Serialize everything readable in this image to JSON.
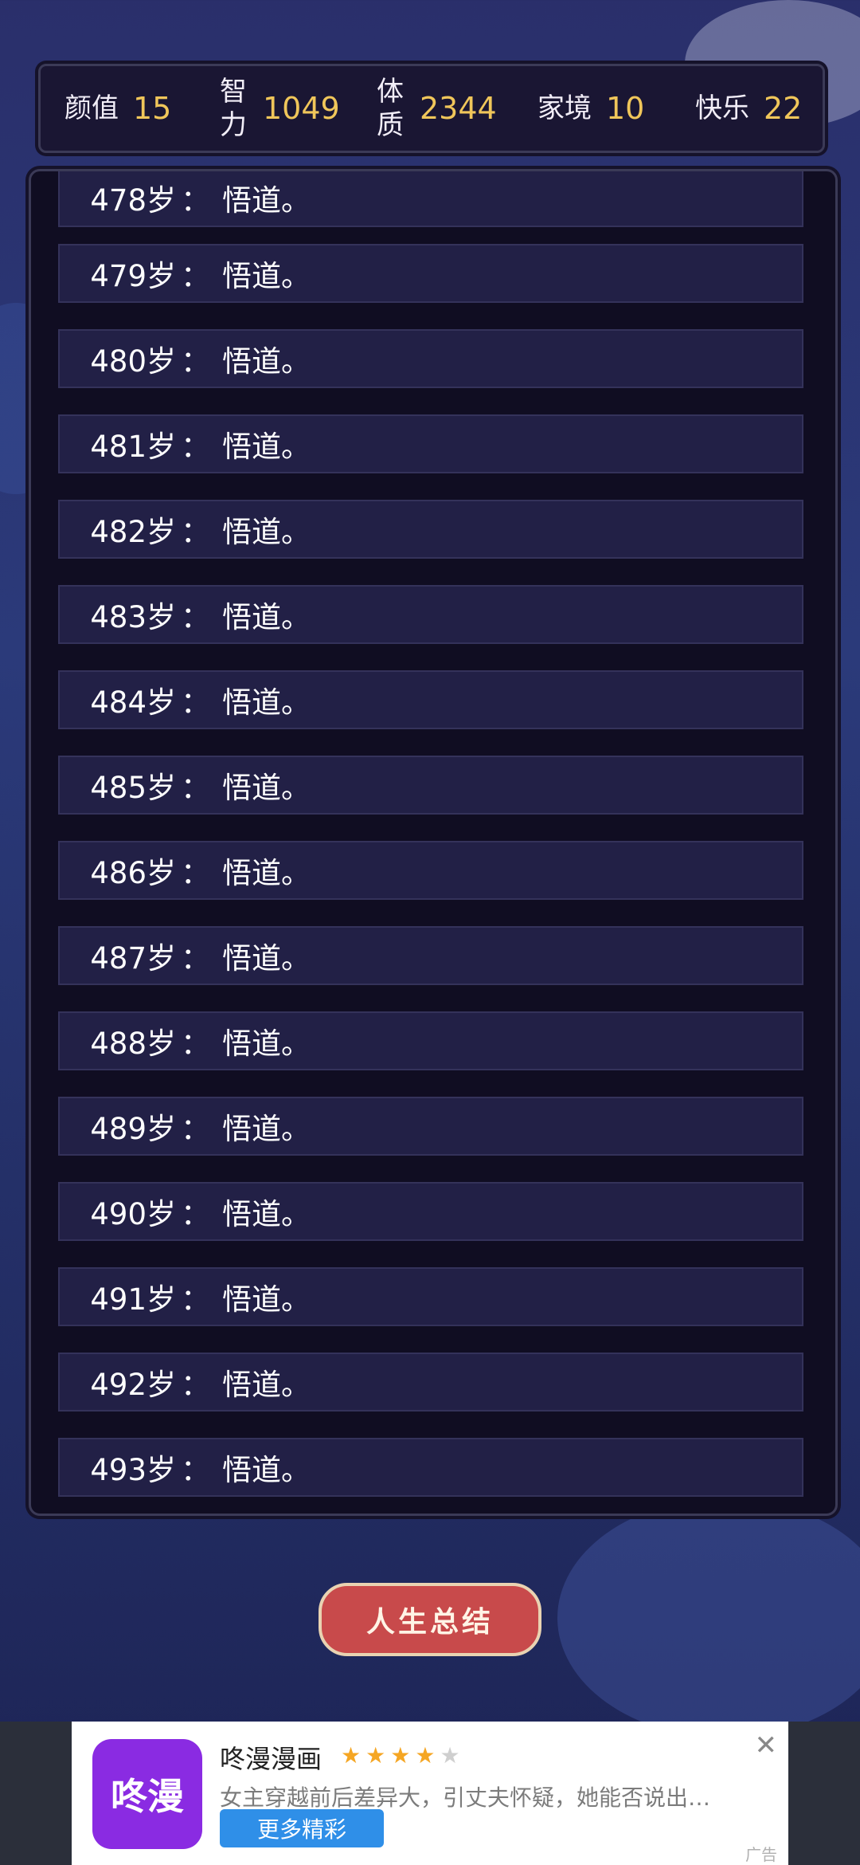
{
  "stats": [
    {
      "label": "颜值",
      "value": "15"
    },
    {
      "label": "智力",
      "value": "1049"
    },
    {
      "label": "体质",
      "value": "2344"
    },
    {
      "label": "家境",
      "value": "10"
    },
    {
      "label": "快乐",
      "value": "22"
    }
  ],
  "log": {
    "colon": "：",
    "rows": [
      {
        "age": "478岁",
        "event": "悟道。"
      },
      {
        "age": "479岁",
        "event": "悟道。"
      },
      {
        "age": "480岁",
        "event": "悟道。"
      },
      {
        "age": "481岁",
        "event": "悟道。"
      },
      {
        "age": "482岁",
        "event": "悟道。"
      },
      {
        "age": "483岁",
        "event": "悟道。"
      },
      {
        "age": "484岁",
        "event": "悟道。"
      },
      {
        "age": "485岁",
        "event": "悟道。"
      },
      {
        "age": "486岁",
        "event": "悟道。"
      },
      {
        "age": "487岁",
        "event": "悟道。"
      },
      {
        "age": "488岁",
        "event": "悟道。"
      },
      {
        "age": "489岁",
        "event": "悟道。"
      },
      {
        "age": "490岁",
        "event": "悟道。"
      },
      {
        "age": "491岁",
        "event": "悟道。"
      },
      {
        "age": "492岁",
        "event": "悟道。"
      },
      {
        "age": "493岁",
        "event": "悟道。"
      }
    ]
  },
  "summary_button": "人生总结",
  "ad": {
    "icon_text": "咚漫",
    "title": "咚漫漫画",
    "rating": 4,
    "rating_max": 5,
    "description": "女主穿越前后差异大，引丈夫怀疑，她能否说出…",
    "cta": "更多精彩",
    "close_icon": "close-icon",
    "tag": "广告"
  },
  "colors": {
    "accent_value": "#f0c65a",
    "button_red": "#c84a4b",
    "row_bg": "#222046",
    "ad_cta": "#2f8fe8",
    "ad_icon": "#8a2be2"
  }
}
